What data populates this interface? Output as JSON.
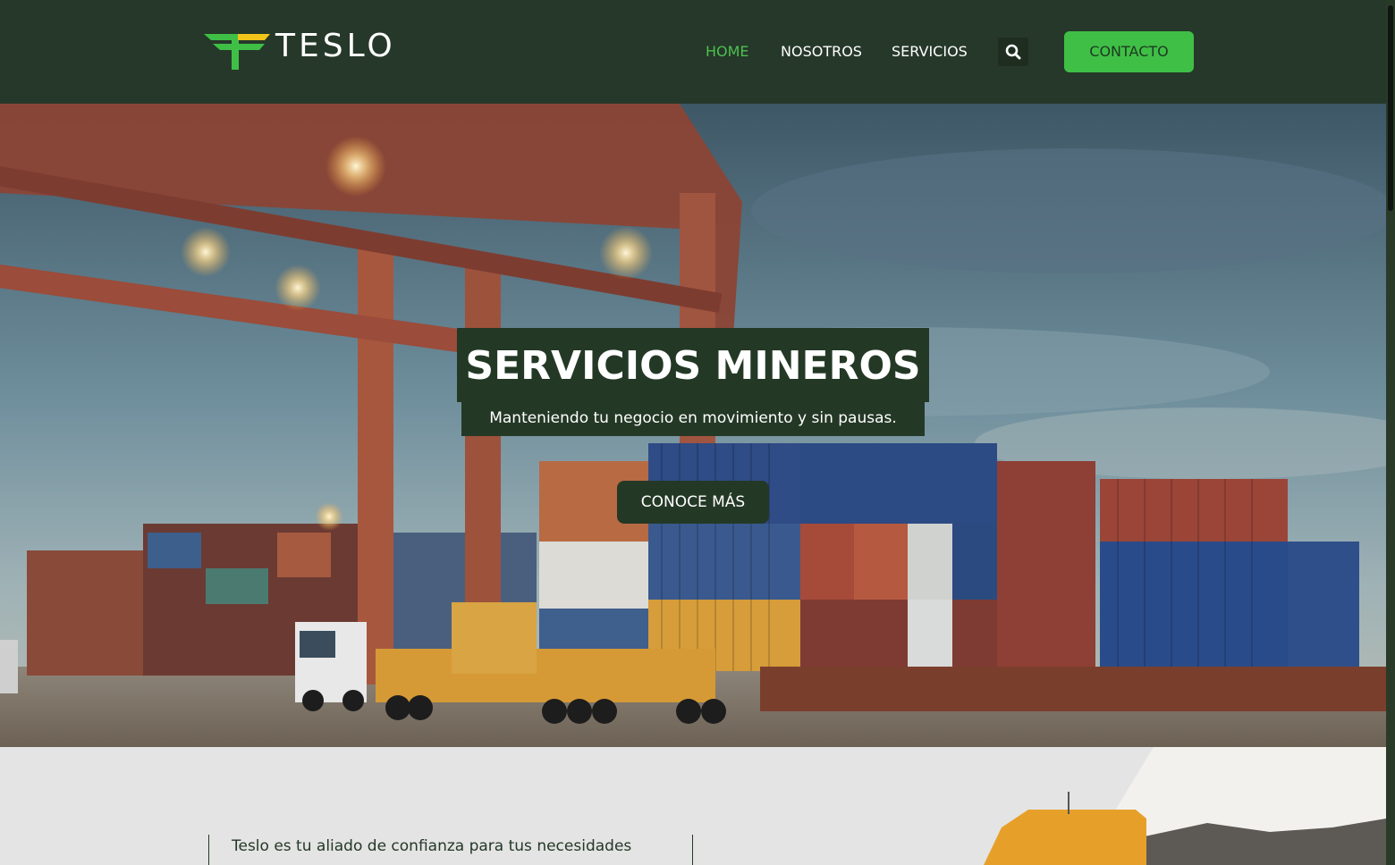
{
  "header": {
    "logo_text": "TESLO",
    "nav": [
      {
        "label": "HOME",
        "active": true
      },
      {
        "label": "NOSOTROS",
        "active": false
      },
      {
        "label": "SERVICIOS",
        "active": false
      }
    ],
    "search_icon": "search-icon",
    "cta_label": "CONTACTO"
  },
  "hero": {
    "title": "SERVICIOS MINEROS",
    "subtitle": "Manteniendo tu negocio en movimiento y sin pausas.",
    "button_label": "CONOCE MÁS"
  },
  "about": {
    "heading": "Teslo es tu aliado de confianza para tus necesidades"
  },
  "colors": {
    "header_bg": "#26382a",
    "accent_green": "#3fbf46",
    "dark_green": "#243826",
    "active_nav": "#4cc04f"
  }
}
